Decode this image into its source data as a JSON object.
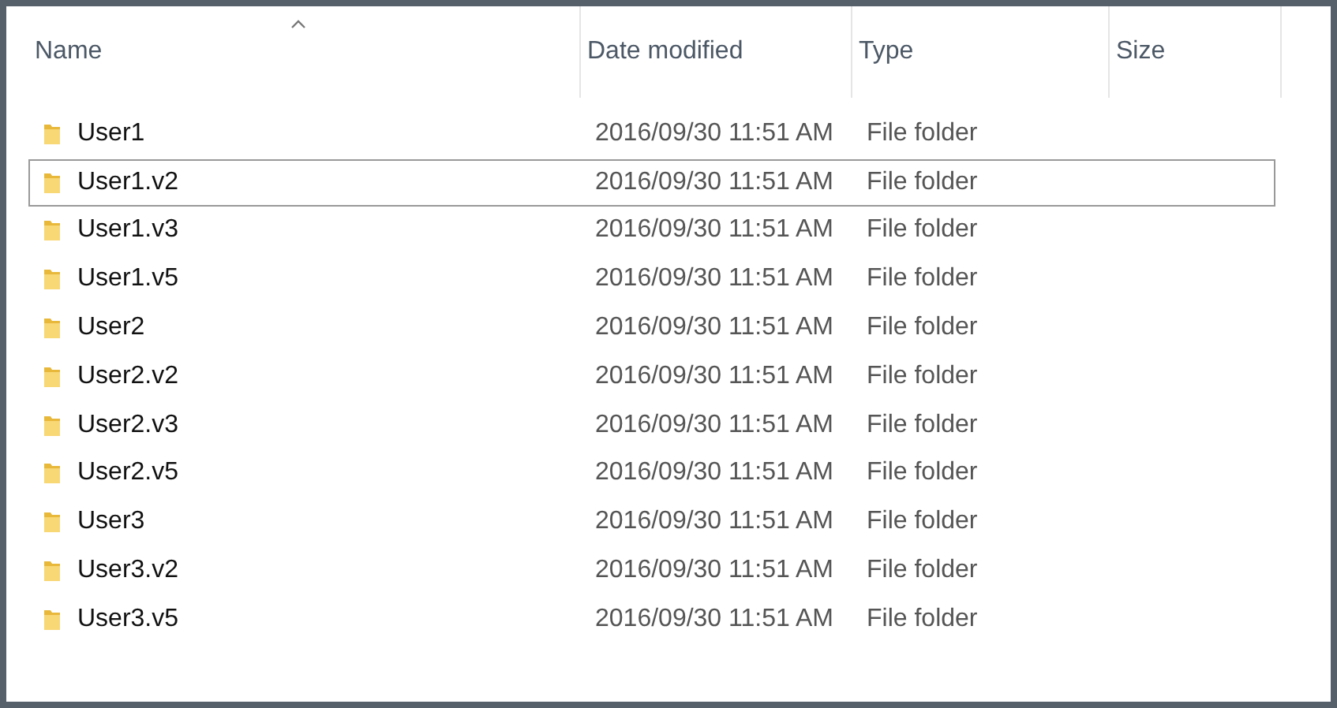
{
  "table": {
    "columns": [
      {
        "label": "Name",
        "sorted": true
      },
      {
        "label": "Date modified"
      },
      {
        "label": "Type"
      },
      {
        "label": "Size"
      }
    ],
    "rows": [
      {
        "name": "User1",
        "date": "2016/09/30 11:51 AM",
        "type": "File folder",
        "focused": false
      },
      {
        "name": "User1.v2",
        "date": "2016/09/30 11:51 AM",
        "type": "File folder",
        "focused": true
      },
      {
        "name": "User1.v3",
        "date": "2016/09/30 11:51 AM",
        "type": "File folder",
        "focused": false
      },
      {
        "name": "User1.v5",
        "date": "2016/09/30 11:51 AM",
        "type": "File folder",
        "focused": false
      },
      {
        "name": "User2",
        "date": "2016/09/30 11:51 AM",
        "type": "File folder",
        "focused": false
      },
      {
        "name": "User2.v2",
        "date": "2016/09/30 11:51 AM",
        "type": "File folder",
        "focused": false
      },
      {
        "name": "User2.v3",
        "date": "2016/09/30 11:51 AM",
        "type": "File folder",
        "focused": false
      },
      {
        "name": "User2.v5",
        "date": "2016/09/30 11:51 AM",
        "type": "File folder",
        "focused": false
      },
      {
        "name": "User3",
        "date": "2016/09/30 11:51 AM",
        "type": "File folder",
        "focused": false
      },
      {
        "name": "User3.v2",
        "date": "2016/09/30 11:51 AM",
        "type": "File folder",
        "focused": false
      },
      {
        "name": "User3.v5",
        "date": "2016/09/30 11:51 AM",
        "type": "File folder",
        "focused": false
      }
    ]
  }
}
